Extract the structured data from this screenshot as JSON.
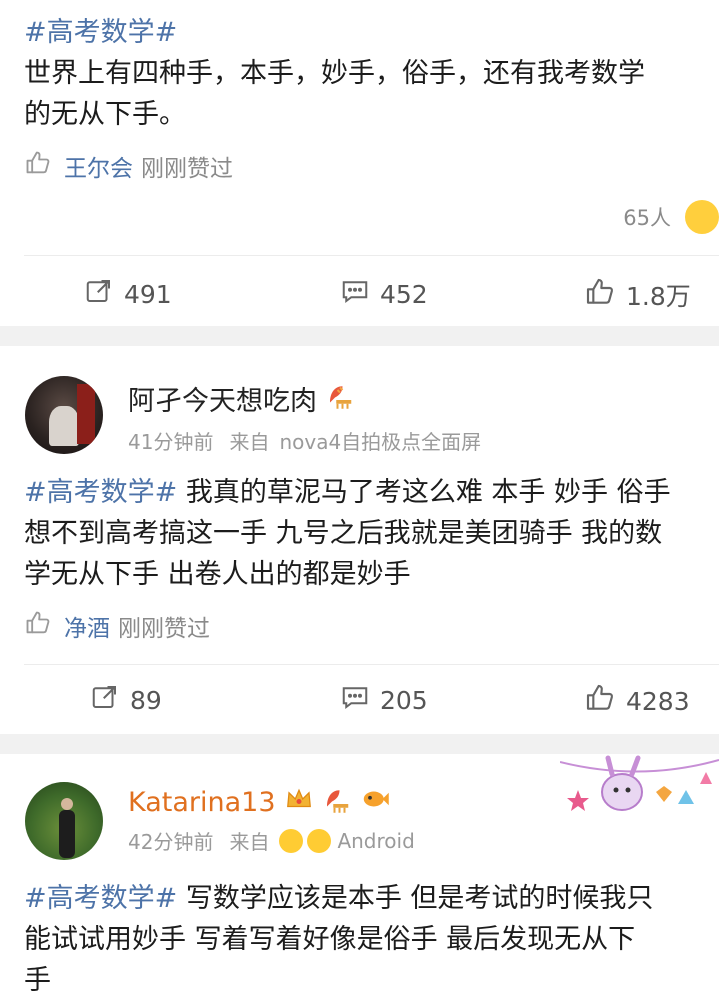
{
  "post1": {
    "topic": "#高考数学#",
    "lines": [
      "世界上有四种手，本手，妙手，俗手，还有我考数学",
      "的无从下手。"
    ],
    "liked_by": "王尔会",
    "liked_suffix": "刚刚赞过",
    "reaction_count": "65人",
    "reposts": "491",
    "comments": "452",
    "likes": "1.8万"
  },
  "post2": {
    "username": "阿孑今天想吃肉",
    "time": "41分钟前",
    "source_prefix": "来自",
    "source": "nova4自拍极点全面屏",
    "topic": "#高考数学#",
    "line1_rest": " 我真的草泥马了考这么难 本手 妙手 俗手",
    "line2": "想不到高考搞这一手 九号之后我就是美团骑手 我的数",
    "line3": "学无从下手 出卷人出的都是妙手",
    "liked_by": "净酒",
    "liked_suffix": "刚刚赞过",
    "reposts": "89",
    "comments": "205",
    "likes": "4283"
  },
  "post3": {
    "username": "Katarina13",
    "time": "42分钟前",
    "source_prefix": "来自",
    "source": "Android",
    "topic": "#高考数学#",
    "line1_rest": " 写数学应该是本手 但是考试的时候我只",
    "line2": "能试试用妙手 写着写着好像是俗手 最后发现无从下",
    "line3": "手"
  },
  "colors": {
    "topic_blue": "#4d73a8",
    "vip_orange": "#e0701f",
    "gap_gray": "#f1f1f1"
  },
  "icons": [
    "like-icon",
    "repost-icon",
    "comment-icon",
    "thumbs-up-icon",
    "emoji-reaction-icon",
    "crown-badge-icon",
    "fan-badge-icon"
  ]
}
